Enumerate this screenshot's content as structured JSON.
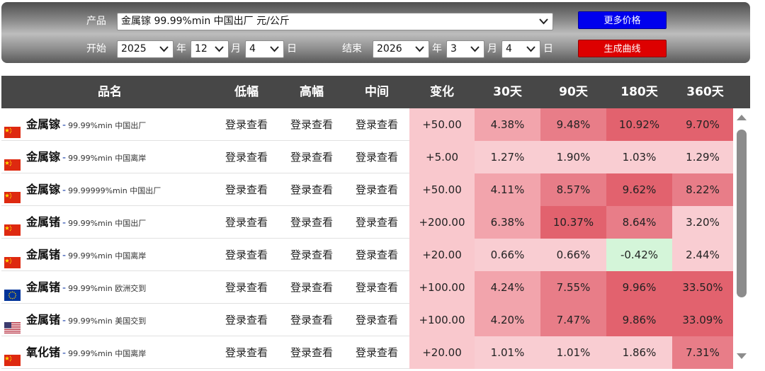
{
  "controls": {
    "product_label": "产品",
    "product_value": "金属镓 99.99%min 中国出厂 元/公斤",
    "start_label": "开始",
    "end_label": "结束",
    "start": {
      "year": "2025",
      "month": "12",
      "day": "4"
    },
    "end": {
      "year": "2026",
      "month": "3",
      "day": "4"
    },
    "year_unit": "年",
    "month_unit": "月",
    "day_unit": "日",
    "more_prices_button": "更多价格",
    "generate_chart_button": "生成曲线",
    "colors": {
      "blue_button": "#0000ee",
      "red_button": "#dd0000"
    }
  },
  "table": {
    "headers": [
      "品名",
      "低幅",
      "高幅",
      "中间",
      "变化",
      "30天",
      "90天",
      "180天",
      "360天"
    ],
    "dash": "-",
    "login_text": "登录查看",
    "rows": [
      {
        "flag": "cn",
        "name": "金属镓",
        "spec": "99.99%min 中国出厂",
        "change": "+50.00",
        "d30": "4.38%",
        "d90": "9.48%",
        "d180": "10.92%",
        "d360": "9.70%"
      },
      {
        "flag": "cn",
        "name": "金属镓",
        "spec": "99.99%min 中国离岸",
        "change": "+5.00",
        "d30": "1.27%",
        "d90": "1.90%",
        "d180": "1.03%",
        "d360": "1.29%"
      },
      {
        "flag": "cn",
        "name": "金属镓",
        "spec": "99.99999%min 中国出厂",
        "change": "+50.00",
        "d30": "4.11%",
        "d90": "8.57%",
        "d180": "9.62%",
        "d360": "8.22%"
      },
      {
        "flag": "cn",
        "name": "金属锗",
        "spec": "99.99%min 中国出厂",
        "change": "+200.00",
        "d30": "6.38%",
        "d90": "10.37%",
        "d180": "8.64%",
        "d360": "3.20%"
      },
      {
        "flag": "cn",
        "name": "金属锗",
        "spec": "99.99%min 中国离岸",
        "change": "+20.00",
        "d30": "0.66%",
        "d90": "0.66%",
        "d180": "-0.42%",
        "d360": "2.44%"
      },
      {
        "flag": "eu",
        "name": "金属锗",
        "spec": "99.99%min 欧洲交到",
        "change": "+100.00",
        "d30": "4.24%",
        "d90": "7.55%",
        "d180": "9.96%",
        "d360": "33.50%"
      },
      {
        "flag": "us",
        "name": "金属锗",
        "spec": "99.99%min 美国交到",
        "change": "+100.00",
        "d30": "4.20%",
        "d90": "7.47%",
        "d180": "9.86%",
        "d360": "33.09%"
      },
      {
        "flag": "cn",
        "name": "氧化锗",
        "spec": "99.99%min 中国离岸",
        "change": "+20.00",
        "d30": "1.01%",
        "d90": "1.01%",
        "d180": "1.86%",
        "d360": "7.31%"
      }
    ]
  },
  "heat_colors": {
    "change_bg": "#f9c8cd",
    "light": "#f9cdd2",
    "mid": "#f2a4ac",
    "strong": "#e87d88",
    "stronger": "#e2626e",
    "negative": "#d4f5d9"
  }
}
